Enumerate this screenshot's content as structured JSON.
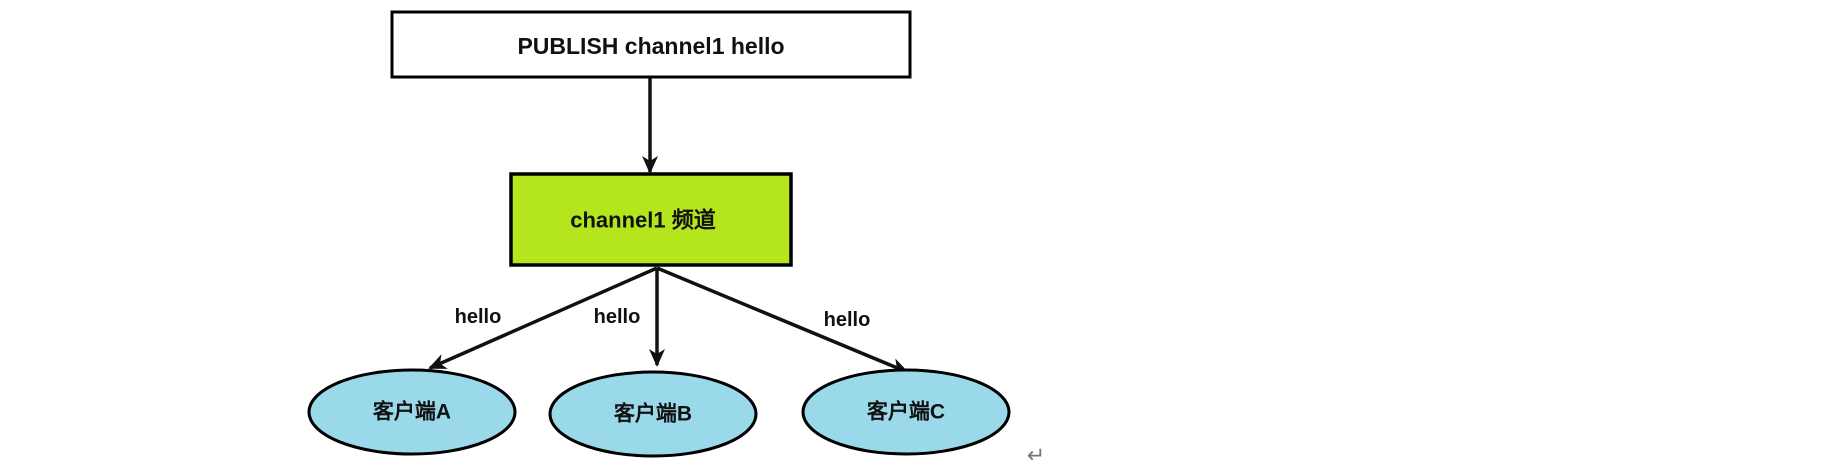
{
  "publisher": {
    "label": "PUBLISH channel1 hello"
  },
  "channel": {
    "label": "channel1 频道"
  },
  "edges": [
    {
      "label": "hello"
    },
    {
      "label": "hello"
    },
    {
      "label": "hello"
    }
  ],
  "clients": [
    {
      "label": "客户端A"
    },
    {
      "label": "客户端B"
    },
    {
      "label": "客户端C"
    }
  ],
  "colors": {
    "publisher_fill": "#ffffff",
    "channel_fill": "#b5e61d",
    "client_fill": "#99d9ea",
    "stroke": "#000000"
  },
  "paragraph_mark": "↵"
}
